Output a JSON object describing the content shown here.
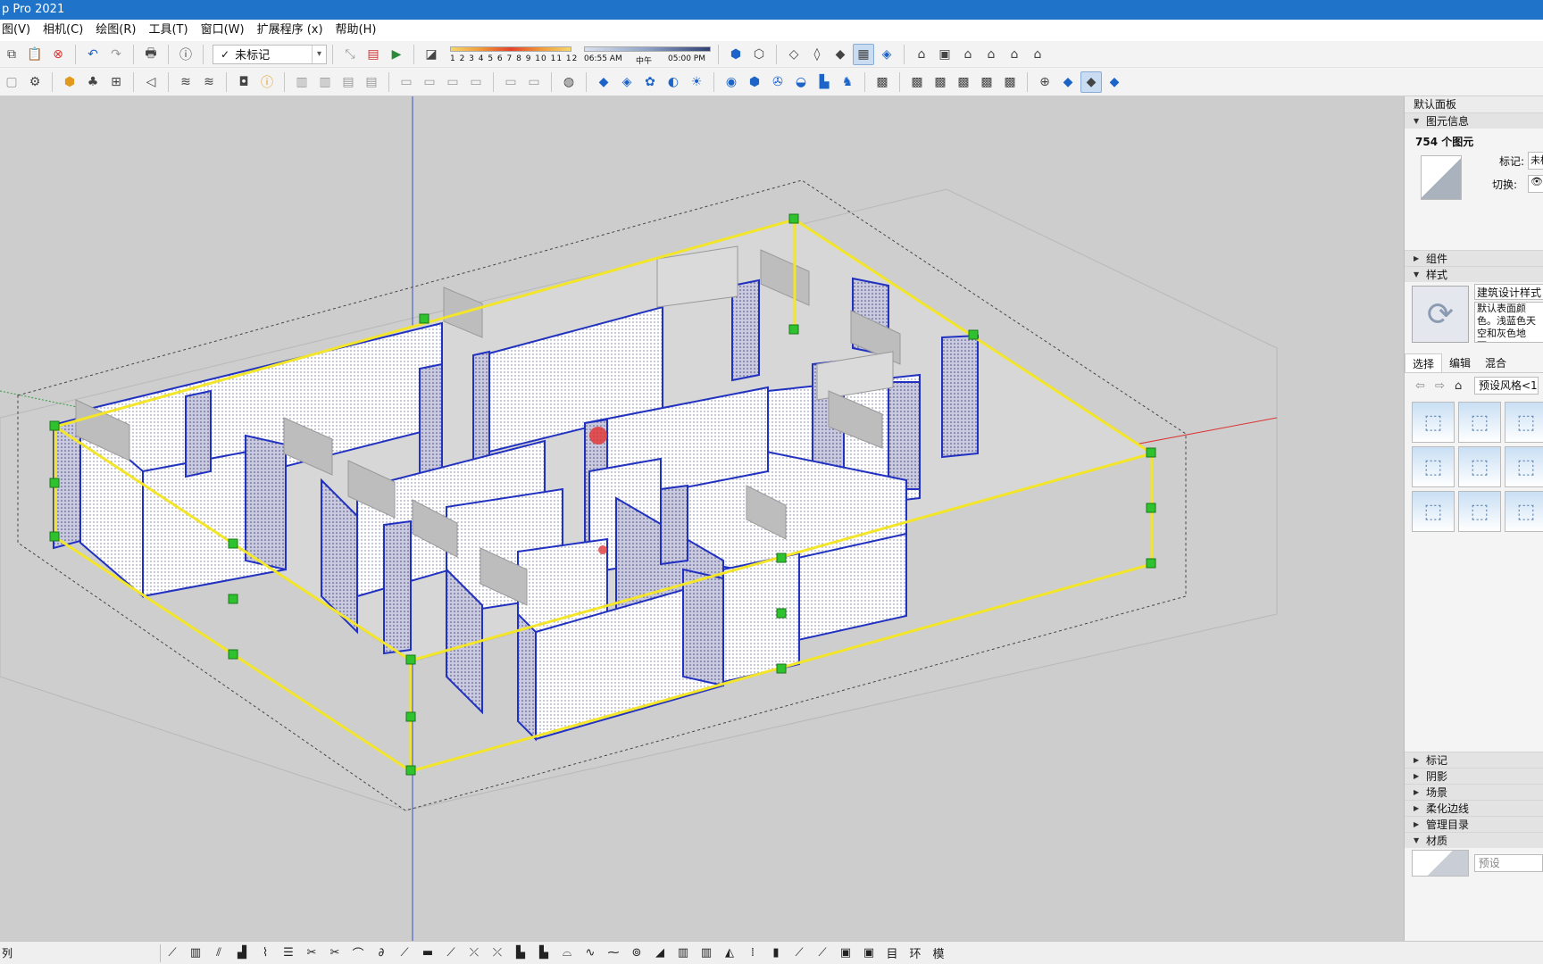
{
  "app": {
    "title": "p Pro 2021"
  },
  "menu": [
    {
      "label": "图(V)"
    },
    {
      "label": "相机(C)"
    },
    {
      "label": "绘图(R)"
    },
    {
      "label": "工具(T)"
    },
    {
      "label": "窗口(W)"
    },
    {
      "label": "扩展程序 (x)"
    },
    {
      "label": "帮助(H)"
    }
  ],
  "toolbar": {
    "tag_select_value": "未标记",
    "shadow_months": "1 2 3 4 5 6 7 8 9 10 11 12",
    "shadow_time_start": "06:55 AM",
    "shadow_time_mid": "中午",
    "shadow_time_end": "05:00 PM"
  },
  "panel": {
    "title": "默认面板",
    "entity_info": {
      "header": "图元信息",
      "count": "754 个图元",
      "tag_label": "标记:",
      "tag_value": "未标",
      "toggle_label": "切换:",
      "toggle_icon": "eye-icon"
    },
    "components_header": "组件",
    "styles": {
      "header": "样式",
      "name": "建筑设计样式",
      "description": "默认表面颜色。浅蓝色天空和灰色地面。",
      "tabs": [
        "选择",
        "编辑",
        "混合"
      ],
      "active_tab": 0,
      "library_select": "预设风格<1"
    },
    "collapsed_sections": [
      "标记",
      "阴影",
      "场景",
      "柔化边线",
      "管理目录"
    ],
    "materials": {
      "header": "材质",
      "search_placeholder": "预设"
    }
  },
  "status_bar": {
    "text": "列"
  }
}
